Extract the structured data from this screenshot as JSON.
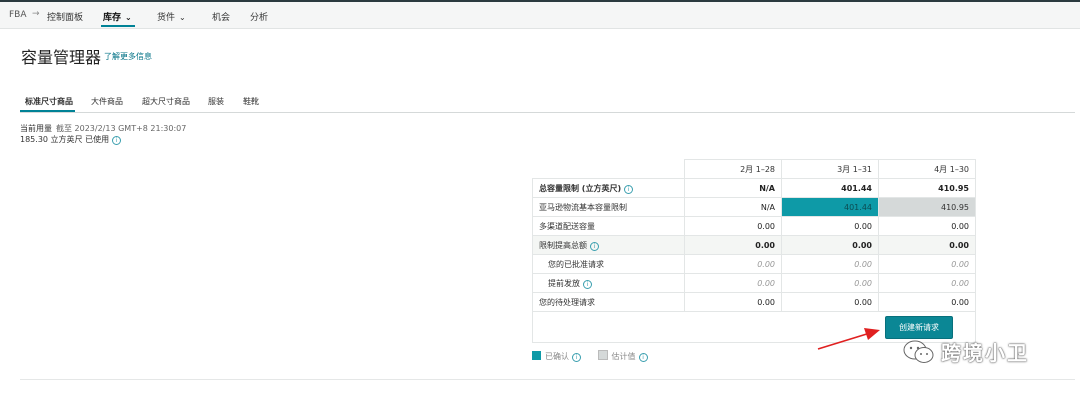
{
  "nav": {
    "fba": "FBA",
    "arrow": "→",
    "dashboard": "控制面板",
    "inventory": "库存",
    "pricing": "货件",
    "opportunities": "机会",
    "analytics": "分析"
  },
  "header": {
    "title": "容量管理器",
    "learn_more": "了解更多信息"
  },
  "tabs": [
    "标准尺寸商品",
    "大件商品",
    "超大尺寸商品",
    "服装",
    "鞋靴"
  ],
  "usage": {
    "label": "当前用量",
    "timestamp": "截至 2023/2/13 GMT+8 21:30:07",
    "value": "185.30 立方英尺 已使用"
  },
  "table": {
    "columns": [
      "2月 1–28",
      "3月 1–31",
      "4月 1–30"
    ],
    "rows": [
      {
        "label": "总容量限制 (立方英尺)",
        "values": [
          "N/A",
          "401.44",
          "410.95"
        ]
      },
      {
        "label": "亚马逊物流基本容量限制",
        "values": [
          "N/A",
          "401.44",
          "410.95"
        ]
      },
      {
        "label": "多渠道配送容量",
        "values": [
          "0.00",
          "0.00",
          "0.00"
        ]
      },
      {
        "label": "限制提高总额",
        "values": [
          "0.00",
          "0.00",
          "0.00"
        ]
      },
      {
        "label": "您的已批准请求",
        "values": [
          "0.00",
          "0.00",
          "0.00"
        ]
      },
      {
        "label": "提前发放",
        "values": [
          "0.00",
          "0.00",
          "0.00"
        ]
      },
      {
        "label": "您的待处理请求",
        "values": [
          "0.00",
          "0.00",
          "0.00"
        ]
      }
    ],
    "create_button": "创建新请求"
  },
  "legend": {
    "confirmed": "已确认",
    "estimated": "估计值"
  },
  "colors": {
    "accent": "#008296",
    "teal_fill": "#0e9aa7",
    "grey_fill": "#d5d9d9",
    "annotation_arrow": "#e02020"
  },
  "watermark": {
    "text": "跨境小卫"
  }
}
